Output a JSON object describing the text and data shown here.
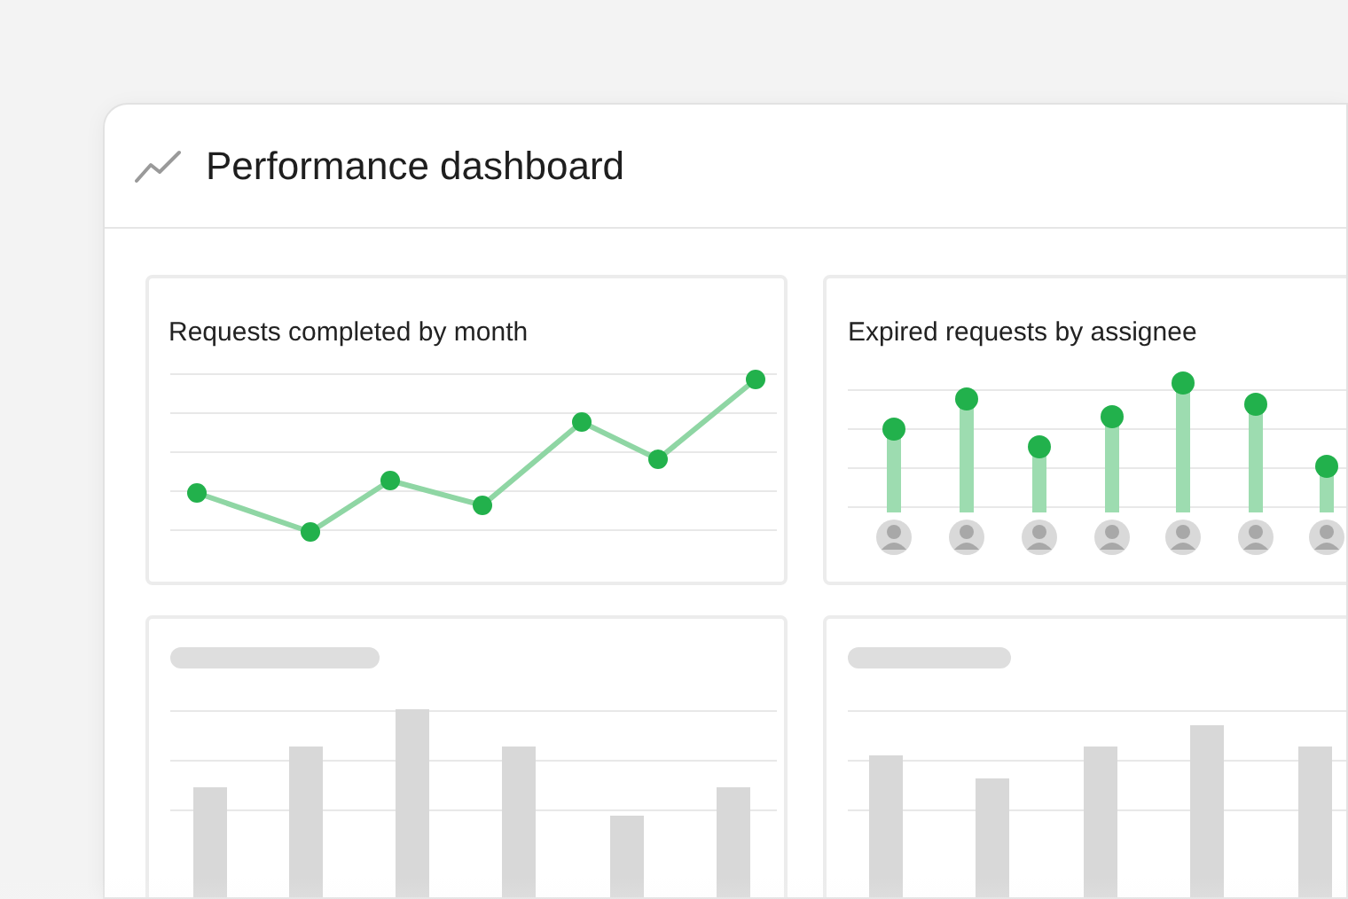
{
  "header": {
    "title": "Performance dashboard"
  },
  "panels": [
    {
      "title": "Requests completed by month"
    },
    {
      "title": "Expired requests by assignee"
    }
  ]
}
